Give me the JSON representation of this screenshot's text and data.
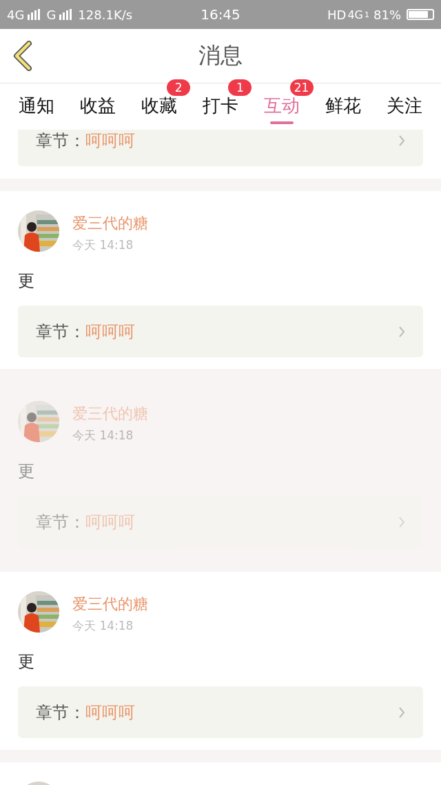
{
  "status_bar": {
    "network_1": "4G",
    "network_2": "G",
    "speed": "128.1K/s",
    "time": "16:45",
    "hd": "HD",
    "network_3": "4G",
    "sim": "1",
    "battery": "81%"
  },
  "header": {
    "title": "消息"
  },
  "tabs": [
    {
      "label": "通知",
      "selected": false
    },
    {
      "label": "收益",
      "selected": false
    },
    {
      "label": "收藏",
      "selected": false,
      "badge": "2"
    },
    {
      "label": "打卡",
      "selected": false,
      "badge": "1"
    },
    {
      "label": "互动",
      "selected": true,
      "badge": "21"
    },
    {
      "label": "鲜花",
      "selected": false
    },
    {
      "label": "关注",
      "selected": false
    }
  ],
  "top_card": {
    "chapter_label": "章节：",
    "chapter": "呵呵呵"
  },
  "cards": [
    {
      "name": "爱三代的糖",
      "time": "今天 14:18",
      "content": "更",
      "chapter_label": "章节：",
      "chapter": "呵呵呵",
      "faded": false
    },
    {
      "name": "爱三代的糖",
      "time": "今天 14:18",
      "content": "更",
      "chapter_label": "章节：",
      "chapter": "呵呵呵",
      "faded": true
    },
    {
      "name": "爱三代的糖",
      "time": "今天 14:18",
      "content": "更",
      "chapter_label": "章节：",
      "chapter": "呵呵呵",
      "faded": false
    }
  ]
}
